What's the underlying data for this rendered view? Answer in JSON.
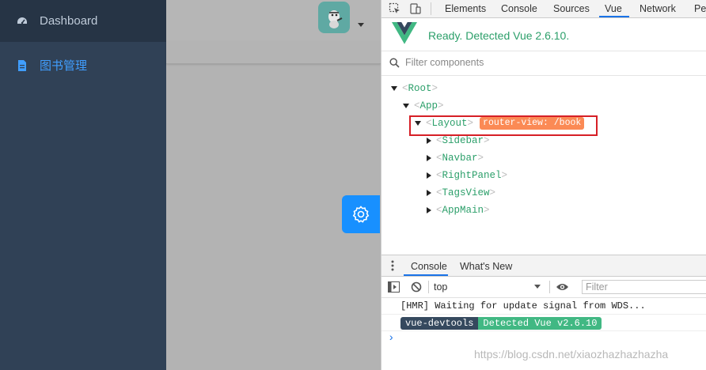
{
  "sidebar": {
    "items": [
      {
        "label": "Dashboard",
        "icon": "dashboard-icon"
      },
      {
        "label": "图书管理",
        "icon": "document-icon",
        "active": true
      }
    ]
  },
  "devtools": {
    "tabs": [
      "Elements",
      "Console",
      "Sources",
      "Vue",
      "Network",
      "Pe"
    ],
    "active_tab": "Vue",
    "vue_status": "Ready. Detected Vue 2.6.10.",
    "filter_placeholder": "Filter components",
    "tree": [
      {
        "name": "Root"
      },
      {
        "name": "App"
      },
      {
        "name": "Layout",
        "tag": "router-view: /book"
      },
      {
        "name": "Sidebar"
      },
      {
        "name": "Navbar"
      },
      {
        "name": "RightPanel"
      },
      {
        "name": "TagsView"
      },
      {
        "name": "AppMain"
      }
    ],
    "drawer_tabs": [
      "Console",
      "What's New"
    ],
    "console": {
      "context": "top",
      "filter_placeholder": "Filter",
      "log": "[HMR] Waiting for update signal from WDS...",
      "badge_left": "vue-devtools",
      "badge_right": "Detected Vue v2.6.10",
      "prompt": "›"
    }
  },
  "watermark": "https://blog.csdn.net/xiaozhazhazhazha",
  "colors": {
    "sidebar_bg": "#304156",
    "active_text": "#409eff",
    "settings_btn": "#1890ff",
    "vue_green": "#41b883",
    "vue_dark": "#35495e",
    "router_tag": "#fb8a55",
    "highlight": "#d61f26"
  }
}
